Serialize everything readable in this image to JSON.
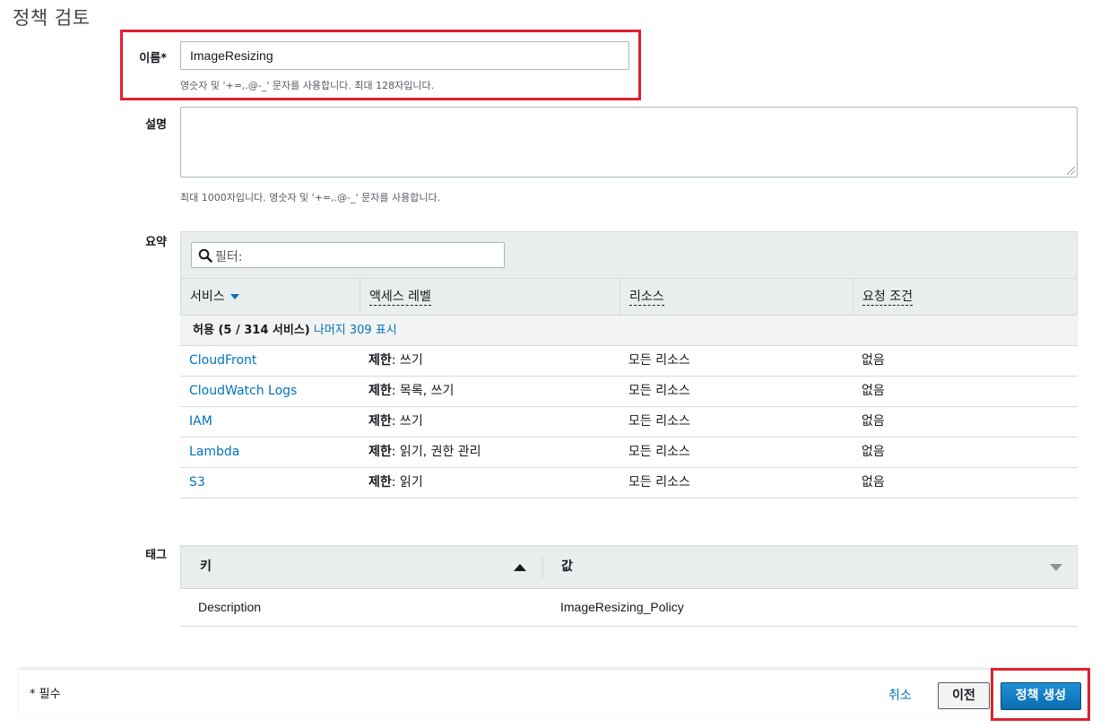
{
  "page": {
    "title": "정책 검토"
  },
  "name_field": {
    "label": "이름*",
    "value": "ImageResizing",
    "hint": "영숫자 및 '+=,.@-_' 문자를 사용합니다. 최대 128자입니다."
  },
  "description_field": {
    "label": "설명",
    "value": "",
    "hint": "최대 1000자입니다. 영숫자 및 '+=,.@-_' 문자를 사용합니다."
  },
  "summary": {
    "label": "요약",
    "filter_placeholder": "필터:",
    "columns": [
      "서비스",
      "액세스 레벨",
      "리소스",
      "요청 조건"
    ],
    "allow_text": "허용 (5 / 314 서비스)",
    "show_more_link": "나머지 309 표시",
    "rows": [
      {
        "service": "CloudFront",
        "level_prefix": "제한",
        "level_rest": ": 쓰기",
        "resource": "모든 리소스",
        "condition": "없음"
      },
      {
        "service": "CloudWatch Logs",
        "level_prefix": "제한",
        "level_rest": ": 목록, 쓰기",
        "resource": "모든 리소스",
        "condition": "없음"
      },
      {
        "service": "IAM",
        "level_prefix": "제한",
        "level_rest": ": 쓰기",
        "resource": "모든 리소스",
        "condition": "없음"
      },
      {
        "service": "Lambda",
        "level_prefix": "제한",
        "level_rest": ": 읽기, 권한 관리",
        "resource": "모든 리소스",
        "condition": "없음"
      },
      {
        "service": "S3",
        "level_prefix": "제한",
        "level_rest": ": 읽기",
        "resource": "모든 리소스",
        "condition": "없음"
      }
    ]
  },
  "tags": {
    "label": "태그",
    "columns": [
      "키",
      "값"
    ],
    "rows": [
      {
        "key": "Description",
        "value": "ImageResizing_Policy"
      }
    ]
  },
  "footer": {
    "required_note": "* 필수",
    "cancel": "취소",
    "previous": "이전",
    "create": "정책 생성"
  },
  "colors": {
    "highlight_red": "#e0202e",
    "link_blue": "#0073bb",
    "primary_button": "#0a6db0"
  }
}
